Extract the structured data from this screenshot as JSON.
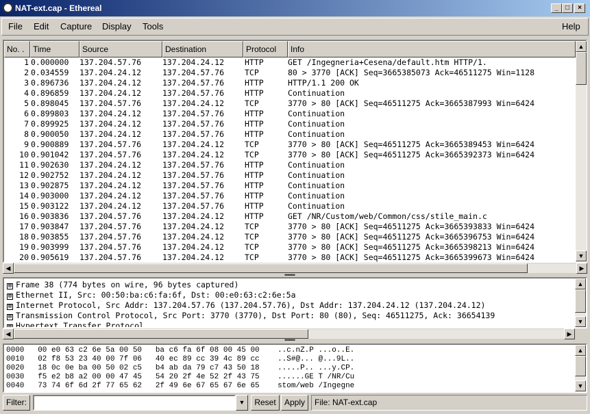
{
  "window": {
    "title": "NAT-ext.cap - Ethereal",
    "minimize": "_",
    "maximize": "□",
    "close": "×"
  },
  "menu": {
    "items": [
      "File",
      "Edit",
      "Capture",
      "Display",
      "Tools"
    ],
    "help": "Help"
  },
  "packet_list": {
    "columns": [
      "No. .",
      "Time",
      "Source",
      "Destination",
      "Protocol",
      "Info"
    ],
    "rows": [
      [
        "1",
        "0.000000",
        "137.204.57.76",
        "137.204.24.12",
        "HTTP",
        "GET /Ingegneria+Cesena/default.htm HTTP/1."
      ],
      [
        "2",
        "0.034559",
        "137.204.24.12",
        "137.204.57.76",
        "TCP",
        "80 > 3770 [ACK] Seq=3665385073 Ack=46511275 Win=1128"
      ],
      [
        "3",
        "0.896736",
        "137.204.24.12",
        "137.204.57.76",
        "HTTP",
        "HTTP/1.1 200 OK"
      ],
      [
        "4",
        "0.896859",
        "137.204.24.12",
        "137.204.57.76",
        "HTTP",
        "Continuation"
      ],
      [
        "5",
        "0.898045",
        "137.204.57.76",
        "137.204.24.12",
        "TCP",
        "3770 > 80 [ACK] Seq=46511275 Ack=3665387993 Win=6424"
      ],
      [
        "6",
        "0.899803",
        "137.204.24.12",
        "137.204.57.76",
        "HTTP",
        "Continuation"
      ],
      [
        "7",
        "0.899925",
        "137.204.24.12",
        "137.204.57.76",
        "HTTP",
        "Continuation"
      ],
      [
        "8",
        "0.900050",
        "137.204.24.12",
        "137.204.57.76",
        "HTTP",
        "Continuation"
      ],
      [
        "9",
        "0.900889",
        "137.204.57.76",
        "137.204.24.12",
        "TCP",
        "3770 > 80 [ACK] Seq=46511275 Ack=3665389453 Win=6424"
      ],
      [
        "10",
        "0.901042",
        "137.204.57.76",
        "137.204.24.12",
        "TCP",
        "3770 > 80 [ACK] Seq=46511275 Ack=3665392373 Win=6424"
      ],
      [
        "11",
        "0.902630",
        "137.204.24.12",
        "137.204.57.76",
        "HTTP",
        "Continuation"
      ],
      [
        "12",
        "0.902752",
        "137.204.24.12",
        "137.204.57.76",
        "HTTP",
        "Continuation"
      ],
      [
        "13",
        "0.902875",
        "137.204.24.12",
        "137.204.57.76",
        "HTTP",
        "Continuation"
      ],
      [
        "14",
        "0.903000",
        "137.204.24.12",
        "137.204.57.76",
        "HTTP",
        "Continuation"
      ],
      [
        "15",
        "0.903122",
        "137.204.24.12",
        "137.204.57.76",
        "HTTP",
        "Continuation"
      ],
      [
        "16",
        "0.903836",
        "137.204.57.76",
        "137.204.24.12",
        "HTTP",
        "GET /NR/Custom/web/Common/css/stile_main.c"
      ],
      [
        "17",
        "0.903847",
        "137.204.57.76",
        "137.204.24.12",
        "TCP",
        "3770 > 80 [ACK] Seq=46511275 Ack=3665393833 Win=6424"
      ],
      [
        "18",
        "0.903855",
        "137.204.57.76",
        "137.204.24.12",
        "TCP",
        "3770 > 80 [ACK] Seq=46511275 Ack=3665396753 Win=6424"
      ],
      [
        "19",
        "0.903999",
        "137.204.57.76",
        "137.204.24.12",
        "TCP",
        "3770 > 80 [ACK] Seq=46511275 Ack=3665398213 Win=6424"
      ],
      [
        "20",
        "0.905619",
        "137.204.57.76",
        "137.204.24.12",
        "TCP",
        "3770 > 80 [ACK] Seq=46511275 Ack=3665399673 Win=6424"
      ]
    ]
  },
  "details": {
    "expander": "⊞",
    "lines": [
      "Frame 38 (774 bytes on wire, 96 bytes captured)",
      "Ethernet II, Src: 00:50:ba:c6:fa:6f, Dst: 00:e0:63:c2:6e:5a",
      "Internet Protocol, Src Addr: 137.204.57.76 (137.204.57.76), Dst Addr: 137.204.24.12 (137.204.24.12)",
      "Transmission Control Protocol, Src Port: 3770 (3770), Dst Port: 80 (80), Seq: 46511275, Ack: 36654139",
      "Hypertext Transfer Protocol"
    ]
  },
  "hex": {
    "lines": [
      "0000   00 e0 63 c2 6e 5a 00 50   ba c6 fa 6f 08 00 45 00    ..c.nZ.P ...o..E.",
      "0010   02 f8 53 23 40 00 7f 06   40 ec 89 cc 39 4c 89 cc    ..S#@... @...9L..",
      "0020   18 0c 0e ba 00 50 02 c5   b4 ab da 79 c7 43 50 18    .....P.. ...y.CP.",
      "0030   f5 e2 b8 a2 00 00 47 45   54 20 2f 4e 52 2f 43 75    ......GE T /NR/Cu",
      "0040   73 74 6f 6d 2f 77 65 62   2f 49 6e 67 65 67 6e 65    stom/web /Ingegne"
    ]
  },
  "filter": {
    "label": "Filter:",
    "value": "",
    "reset": "Reset",
    "apply": "Apply",
    "status": "File: NAT-ext.cap"
  }
}
